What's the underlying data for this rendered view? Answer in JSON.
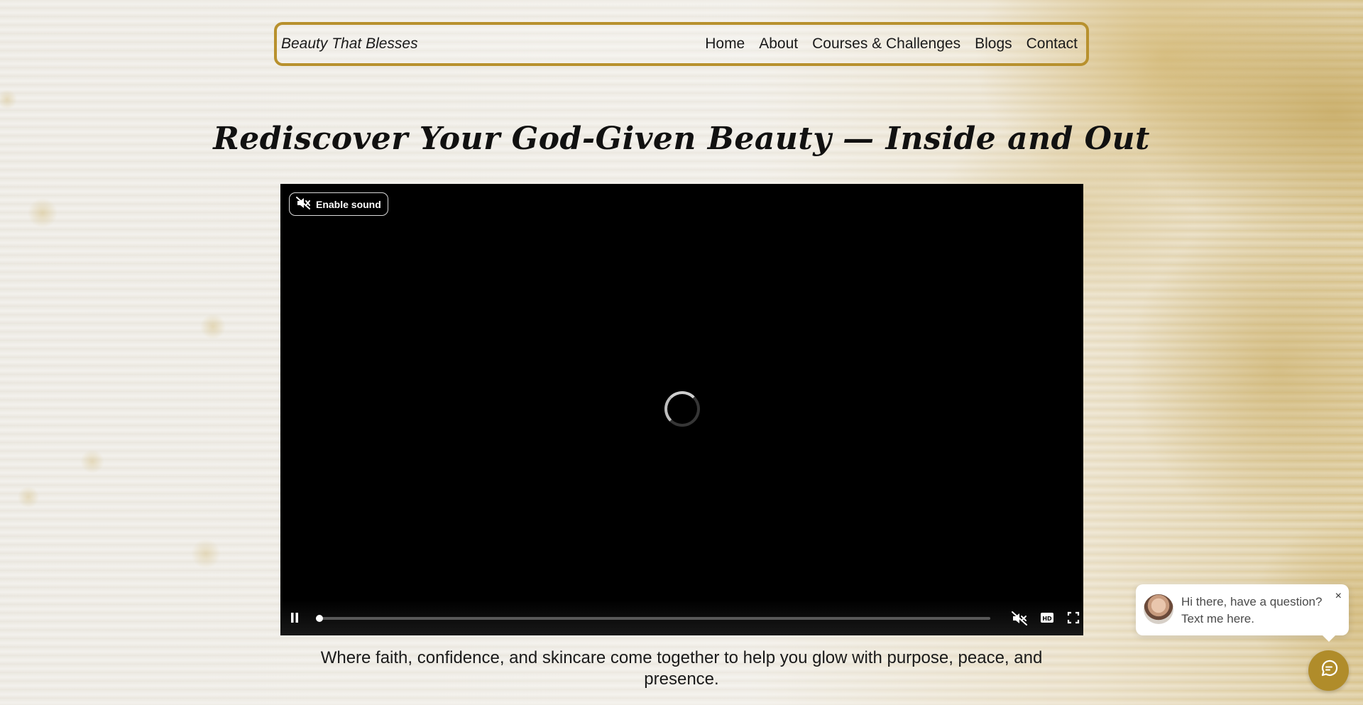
{
  "nav": {
    "brand": "Beauty That Blesses",
    "links": [
      "Home",
      "About",
      "Courses & Challenges",
      "Blogs",
      "Contact"
    ]
  },
  "hero": {
    "title": "Rediscover Your God-Given Beauty — Inside and Out"
  },
  "video": {
    "sound_label": "Enable sound",
    "progress": 0.005,
    "icons": [
      "muted-speaker-icon",
      "loading-spinner",
      "pause-icon",
      "mute-icon",
      "hd-icon",
      "fullscreen-icon"
    ]
  },
  "tagline": "Where faith, confidence, and skincare come together to help you glow with purpose, peace, and presence.",
  "chat": {
    "message": "Hi there, have a question? Text me here.",
    "close_label": "×"
  },
  "colors": {
    "accent_gold": "#b8912e",
    "launcher_gold": "#b08c2a",
    "video_bg": "#000000"
  }
}
